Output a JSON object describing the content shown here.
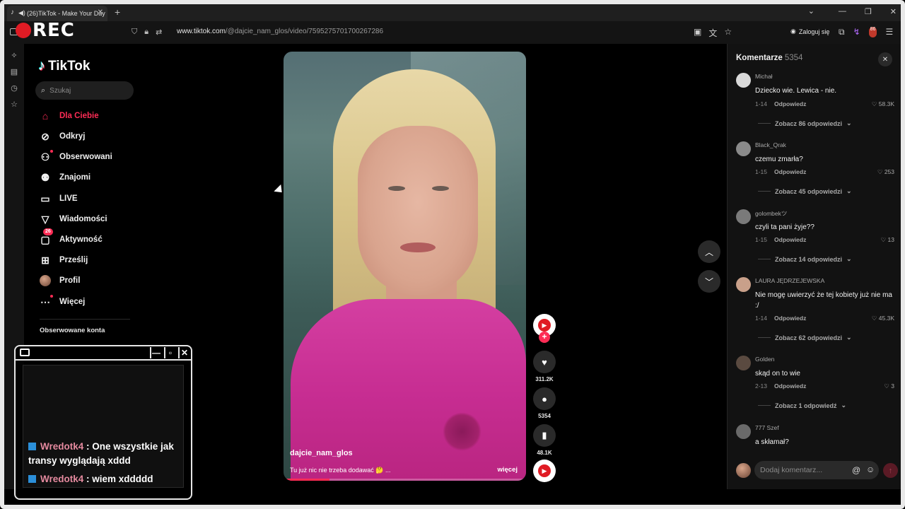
{
  "browser": {
    "tab_title": "(26)TikTok - Make Your Day",
    "new_tab": "+",
    "rec_label": "REC",
    "url_host": "www.tiktok.com",
    "url_path": "/@dajcie_nam_glos/video/7595275701700267286",
    "login_label": "Zaloguj się",
    "ext_badge": "86"
  },
  "tiktok": {
    "logo": "TikTok",
    "search_placeholder": "Szukaj",
    "nav": [
      {
        "label": "Dla Ciebie",
        "icon": "home-icon"
      },
      {
        "label": "Odkryj",
        "icon": "compass-icon"
      },
      {
        "label": "Obserwowani",
        "icon": "following-icon"
      },
      {
        "label": "Znajomi",
        "icon": "friends-icon"
      },
      {
        "label": "LIVE",
        "icon": "live-icon"
      },
      {
        "label": "Wiadomości",
        "icon": "messages-icon"
      },
      {
        "label": "Aktywność",
        "icon": "activity-icon",
        "badge": "26"
      },
      {
        "label": "Prześlij",
        "icon": "upload-icon"
      },
      {
        "label": "Profil",
        "icon": "avatar"
      },
      {
        "label": "Więcej",
        "icon": "more-icon"
      }
    ],
    "followed_header": "Obserwowane konta"
  },
  "video": {
    "author": "dajcie_nam_glos",
    "description": "Tu już nic nie trzeba dodawać 🤔 ...",
    "more": "więcej",
    "progress": 0.19,
    "likes": "311.2K",
    "comments": "5354",
    "saves": "48.1K"
  },
  "comments_panel": {
    "title": "Komentarze",
    "count": "5354",
    "reply_label": "Odpowiedz",
    "input_placeholder": "Dodaj komentarz...",
    "items": [
      {
        "user": "Michał",
        "text": "Dziecko wie. Lewica - nie.",
        "date": "1-14",
        "likes": "58.3K",
        "replies": "Zobacz 86 odpowiedzi",
        "avatar_color": "#d9d9d9"
      },
      {
        "user": "Black_Qrak",
        "text": "czemu zmarła?",
        "date": "1-15",
        "likes": "253",
        "replies": "Zobacz 45 odpowiedzi",
        "avatar_color": "#8a8a8a"
      },
      {
        "user": "golombekツ",
        "text": "czyli ta pani żyje??",
        "date": "1-15",
        "likes": "13",
        "replies": "Zobacz 14 odpowiedzi",
        "avatar_color": "#7a7a7a"
      },
      {
        "user": "LAURA JĘDRZEJEWSKA",
        "text": "Nie mogę uwierzyć że tej kobiety już nie ma :/",
        "date": "1-14",
        "likes": "45.3K",
        "replies": "Zobacz 62 odpowiedzi",
        "avatar_color": "#c9a08a"
      },
      {
        "user": "Golden",
        "text": "skąd on to wie",
        "date": "2-13",
        "likes": "3",
        "replies": "Zobacz 1 odpowiedź",
        "avatar_color": "#5a4a40"
      },
      {
        "user": "777 Szef",
        "text": "a skłamał?",
        "date": "",
        "likes": "",
        "replies": "",
        "avatar_color": "#6a6a6a"
      }
    ]
  },
  "chat_overlay": {
    "messages": [
      {
        "nick": "Wredotk4",
        "text": "One wszystkie jak transy wyglądają xddd"
      },
      {
        "nick": "Wredotk4",
        "text": "wiem xddddd"
      }
    ]
  },
  "colors": {
    "accent": "#fe2c55",
    "rec": "#e01b24",
    "chat_nick": "#e58a9f"
  }
}
